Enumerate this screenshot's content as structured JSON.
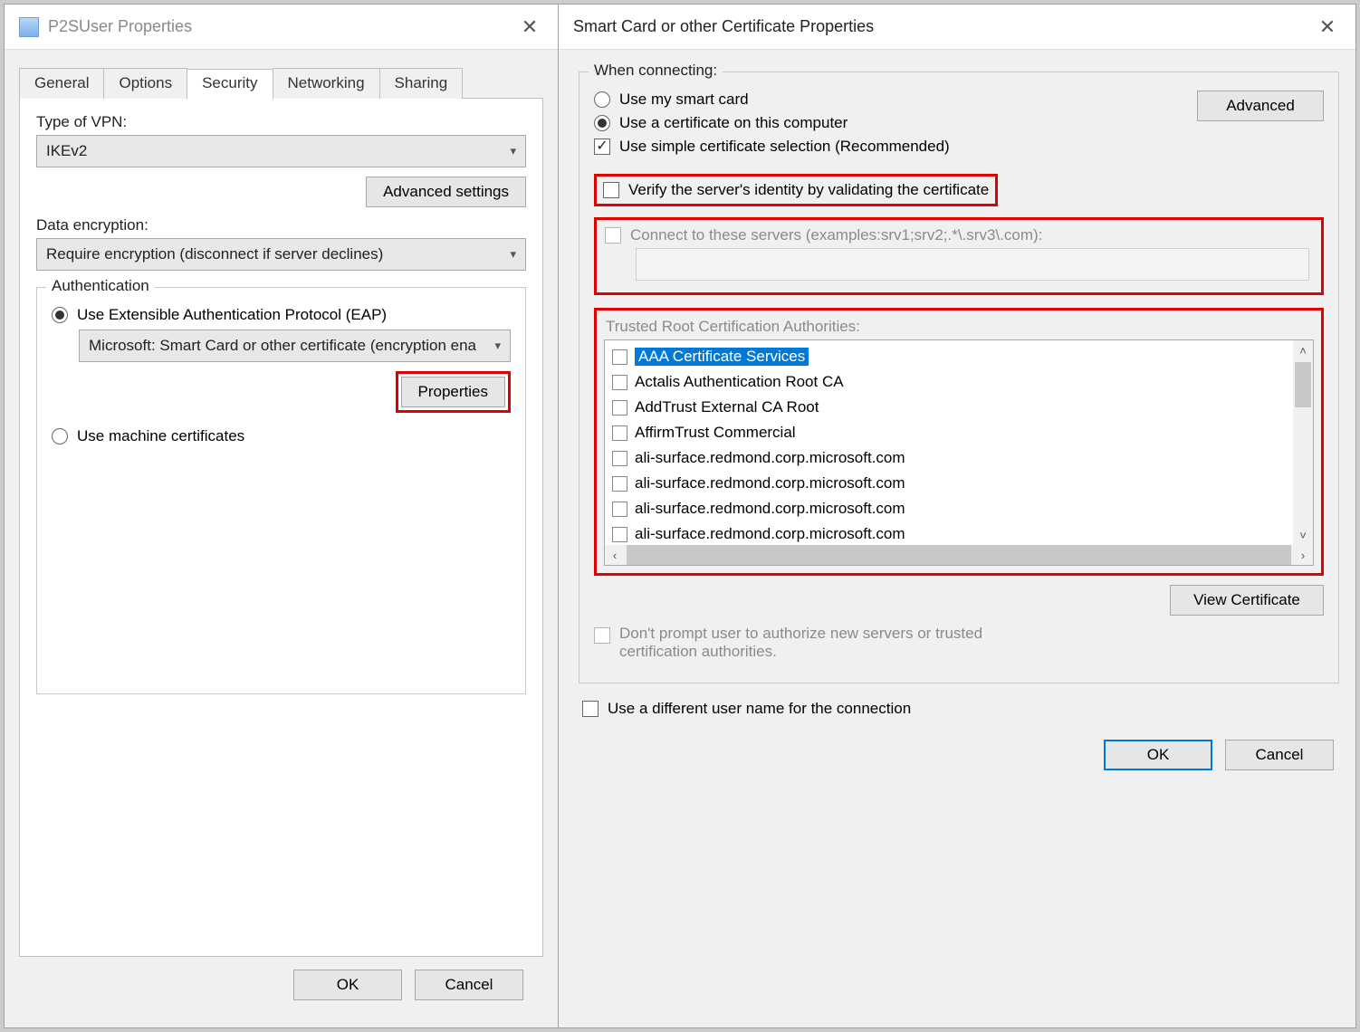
{
  "left": {
    "title": "P2SUser Properties",
    "tabs": [
      "General",
      "Options",
      "Security",
      "Networking",
      "Sharing"
    ],
    "active_tab": "Security",
    "vpn_type_label": "Type of VPN:",
    "vpn_type_value": "IKEv2",
    "advanced_settings": "Advanced settings",
    "data_encryption_label": "Data encryption:",
    "data_encryption_value": "Require encryption (disconnect if server declines)",
    "auth": {
      "legend": "Authentication",
      "eap_label": "Use Extensible Authentication Protocol (EAP)",
      "eap_combo": "Microsoft: Smart Card or other certificate (encryption ena",
      "properties": "Properties",
      "machine_cert_label": "Use machine certificates"
    },
    "ok": "OK",
    "cancel": "Cancel"
  },
  "right": {
    "title": "Smart Card or other Certificate Properties",
    "when_connecting": {
      "legend": "When connecting:",
      "smart_card": "Use my smart card",
      "cert_computer": "Use a certificate on this computer",
      "simple_sel": "Use simple certificate selection (Recommended)",
      "advanced": "Advanced"
    },
    "verify_label": "Verify the server's identity by validating the certificate",
    "connect_servers_label": "Connect to these servers (examples:srv1;srv2;.*\\.srv3\\.com):",
    "trusted_label": "Trusted Root Certification Authorities:",
    "trusted_items": [
      "AAA Certificate Services",
      "Actalis Authentication Root CA",
      "AddTrust External CA Root",
      "AffirmTrust Commercial",
      "ali-surface.redmond.corp.microsoft.com",
      "ali-surface.redmond.corp.microsoft.com",
      "ali-surface.redmond.corp.microsoft.com",
      "ali-surface.redmond.corp.microsoft.com"
    ],
    "view_cert": "View Certificate",
    "dont_prompt": "Don't prompt user to authorize new servers or trusted certification authorities.",
    "diff_username": "Use a different user name for the connection",
    "ok": "OK",
    "cancel": "Cancel"
  }
}
